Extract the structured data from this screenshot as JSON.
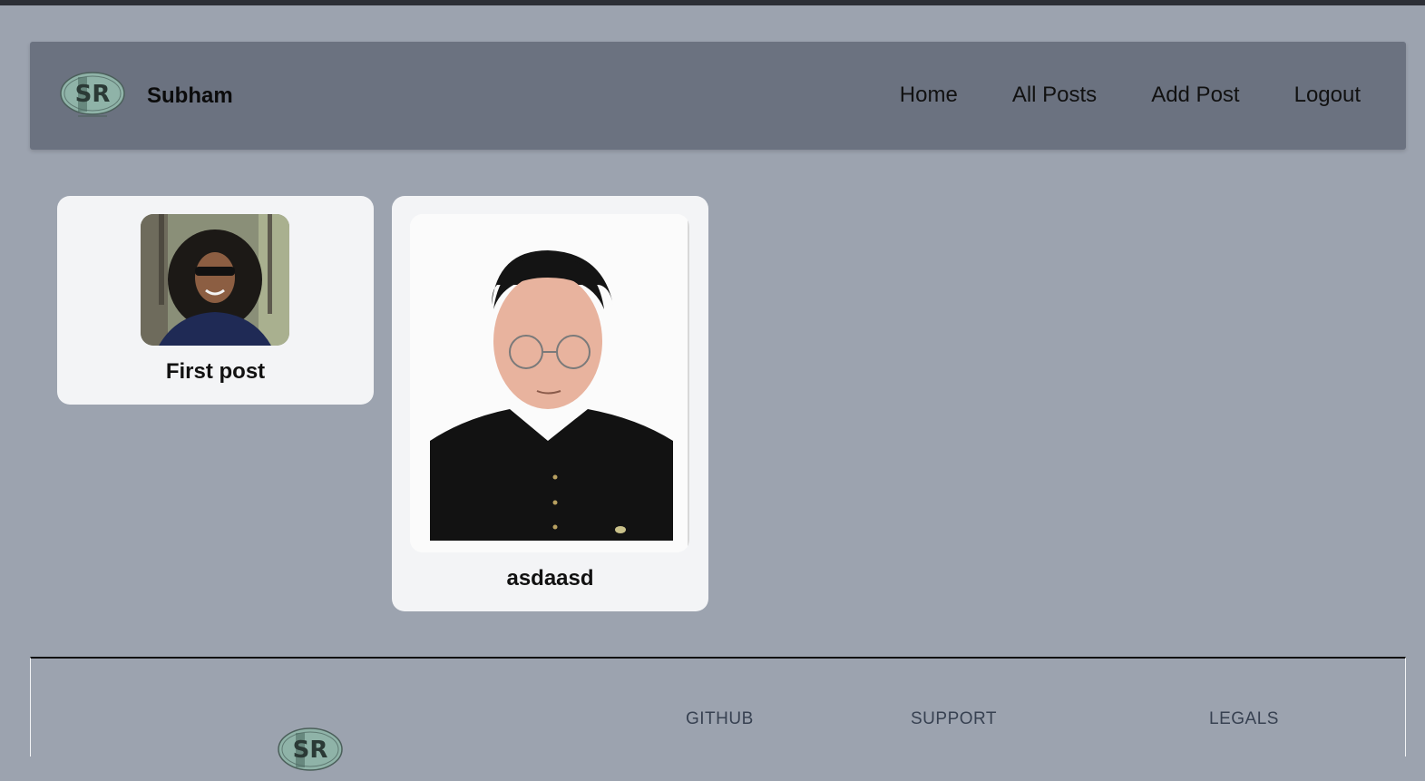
{
  "header": {
    "brand": "Subham",
    "logo_text": "SR",
    "nav": [
      {
        "label": "Home"
      },
      {
        "label": "All Posts"
      },
      {
        "label": "Add Post"
      },
      {
        "label": "Logout"
      }
    ]
  },
  "posts": [
    {
      "title": "First post"
    },
    {
      "title": "asdaasd"
    }
  ],
  "footer": {
    "logo_text": "SR",
    "columns": [
      {
        "heading": "GITHUB"
      },
      {
        "heading": "SUPPORT"
      },
      {
        "heading": "LEGALS"
      }
    ]
  },
  "colors": {
    "page_bg": "#9ca3af",
    "header_bg": "#6b7280",
    "card_bg": "#f3f4f6"
  }
}
